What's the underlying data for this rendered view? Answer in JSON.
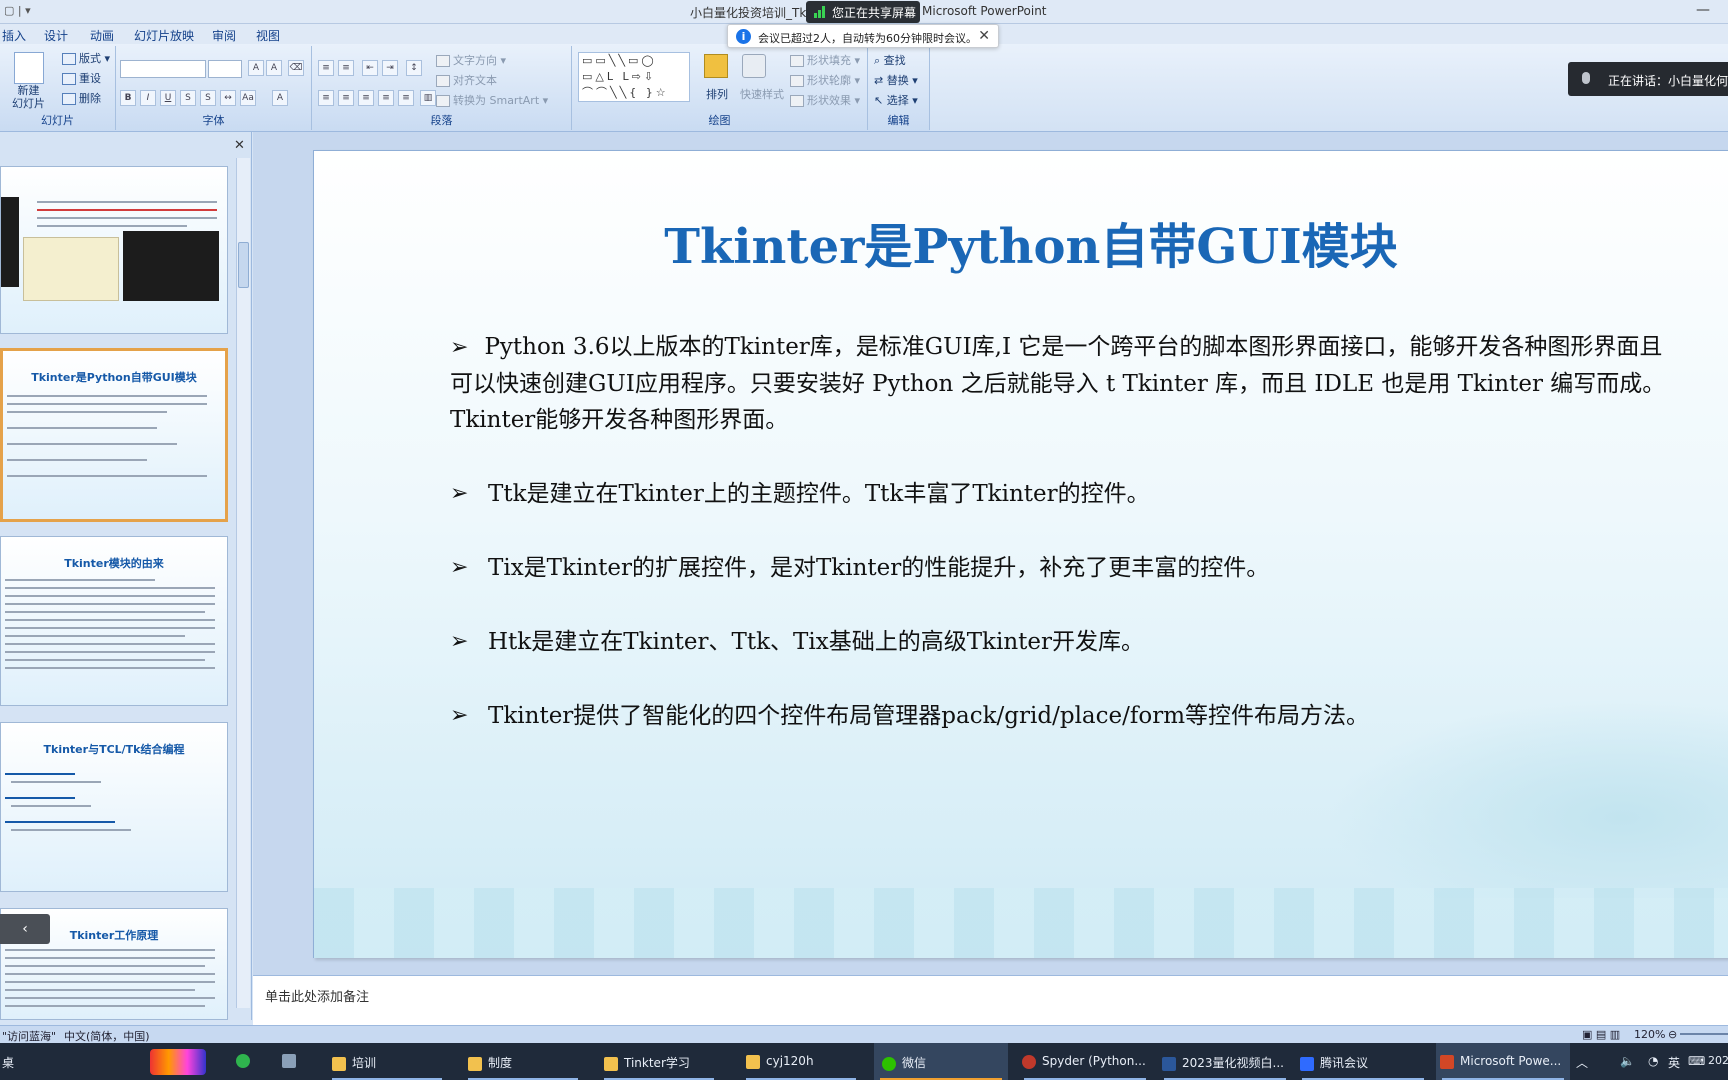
{
  "window": {
    "title_left": "小白量化投资培训_Tki",
    "sharing_label": "您正在共享屏幕",
    "title_right": "Microsoft PowerPoint"
  },
  "toast": {
    "message": "会议已超过2人，自动转为60分钟限时会议。"
  },
  "speaking": {
    "label": "正在讲话：小白量化何"
  },
  "ribbon": {
    "tabs": [
      "插入",
      "设计",
      "动画",
      "幻灯片放映",
      "审阅",
      "视图"
    ],
    "groups": {
      "slides": {
        "label": "幻灯片",
        "new_slide": "新建\n幻灯片",
        "layout": "版式",
        "reset": "重设",
        "delete": "删除"
      },
      "font": {
        "label": "字体"
      },
      "paragraph": {
        "label": "段落",
        "text_direction": "文字方向",
        "align_text": "对齐文本",
        "smartart": "转换为 SmartArt"
      },
      "drawing": {
        "label": "绘图",
        "arrange": "排列",
        "quick_styles": "快速样式",
        "shape_fill": "形状填充",
        "shape_outline": "形状轮廓",
        "shape_effects": "形状效果"
      },
      "editing": {
        "label": "编辑",
        "find": "查找",
        "replace": "替换",
        "select": "选择"
      }
    }
  },
  "thumbnails": [
    {
      "title": "",
      "selected": false
    },
    {
      "title": "Tkinter是Python自带GUI模块",
      "selected": true
    },
    {
      "title": "Tkinter模块的由来",
      "selected": false
    },
    {
      "title": "Tkinter与TCL/Tk结合编程",
      "selected": false
    },
    {
      "title": "Tkinter工作原理",
      "selected": false
    }
  ],
  "slide": {
    "title": "Tkinter是Python自带GUI模块",
    "bullets": [
      "Python 3.6以上版本的Tkinter库，是标准GUI库,I 它是一个跨平台的脚本图形界面接口，能够开发各种图形界面且可以快速创建GUI应用程序。只要安装好 Python 之后就能导入 t Tkinter 库，而且 IDLE 也是用 Tkinter 编写而成。Tkinter能够开发各种图形界面。",
      "Ttk是建立在Tkinter上的主题控件。Ttk丰富了Tkinter的控件。",
      "Tix是Tkinter的扩展控件，是对Tkinter的性能提升，补充了更丰富的控件。",
      "Htk是建立在Tkinter、Ttk、Tix基础上的高级Tkinter开发库。",
      "Tkinter提供了智能化的四个控件布局管理器pack/grid/place/form等控件布局方法。"
    ]
  },
  "notes": {
    "placeholder": "单击此处添加备注"
  },
  "status": {
    "theme": "\"访问蓝海\"",
    "language": "中文(简体，中国)",
    "zoom": "120%"
  },
  "taskbar": {
    "start": "桌",
    "items": [
      {
        "label": "培训",
        "color": "#f2c14e"
      },
      {
        "label": "制度",
        "color": "#f2c14e"
      },
      {
        "label": "Tinkter学习",
        "color": "#f2c14e"
      },
      {
        "label": "cyj120h",
        "color": "#f2c14e"
      },
      {
        "label": "微信",
        "color": "#2dc100"
      },
      {
        "label": "Spyder (Python...",
        "color": "#c0392b"
      },
      {
        "label": "2023量化视频白...",
        "color": "#2b579a"
      },
      {
        "label": "腾讯会议",
        "color": "#2f6bff"
      },
      {
        "label": "Microsoft Powe...",
        "color": "#d24726"
      }
    ],
    "tray_lang": "英",
    "tray_time": "202"
  },
  "colors": {
    "accent": "#1a67b6",
    "ribbon": "#dfe9f6",
    "taskbar": "#1f2a3a"
  }
}
